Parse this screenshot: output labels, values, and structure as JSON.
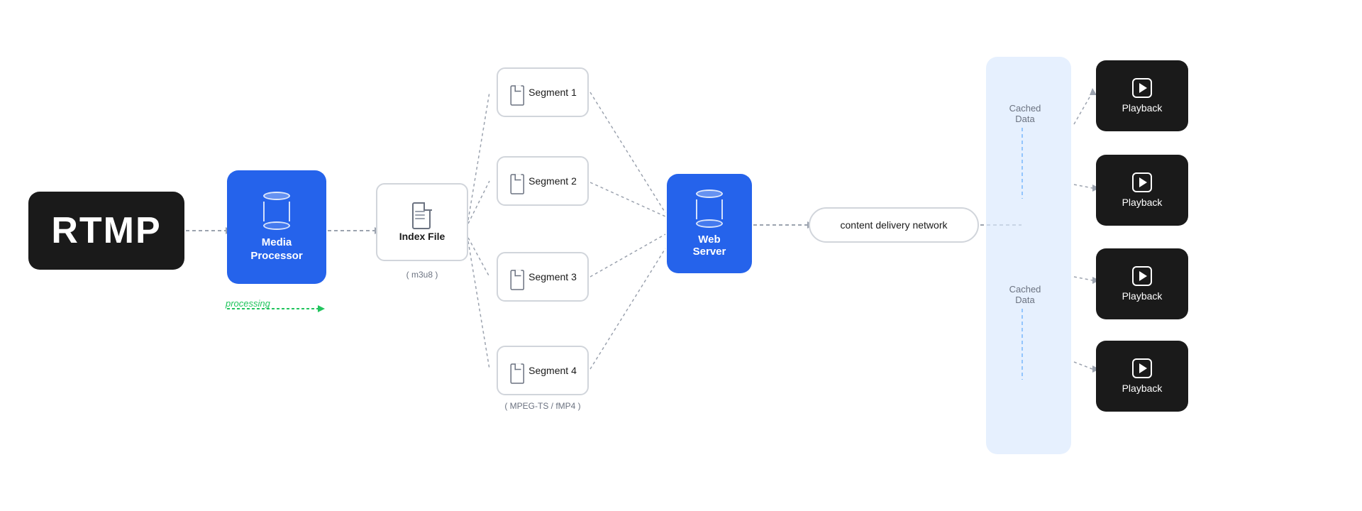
{
  "diagram": {
    "rtmp": {
      "label": "RTMP"
    },
    "mediaProcessor": {
      "label": "Media\nProcessor"
    },
    "processingText": "processing",
    "indexFile": {
      "label": "Index File",
      "sublabel": "( m3u8 )"
    },
    "segments": [
      {
        "label": "Segment 1"
      },
      {
        "label": "Segment 2"
      },
      {
        "label": "Segment 3"
      },
      {
        "label": "Segment 4"
      }
    ],
    "segmentSublabel": "( MPEG-TS / fMP4 )",
    "webServer": {
      "label": "Web\nServer"
    },
    "cdn": {
      "label": "content delivery network"
    },
    "cachedData1": "Cached\nData",
    "cachedData2": "Cached\nData",
    "playback": {
      "label": "Playback"
    }
  }
}
